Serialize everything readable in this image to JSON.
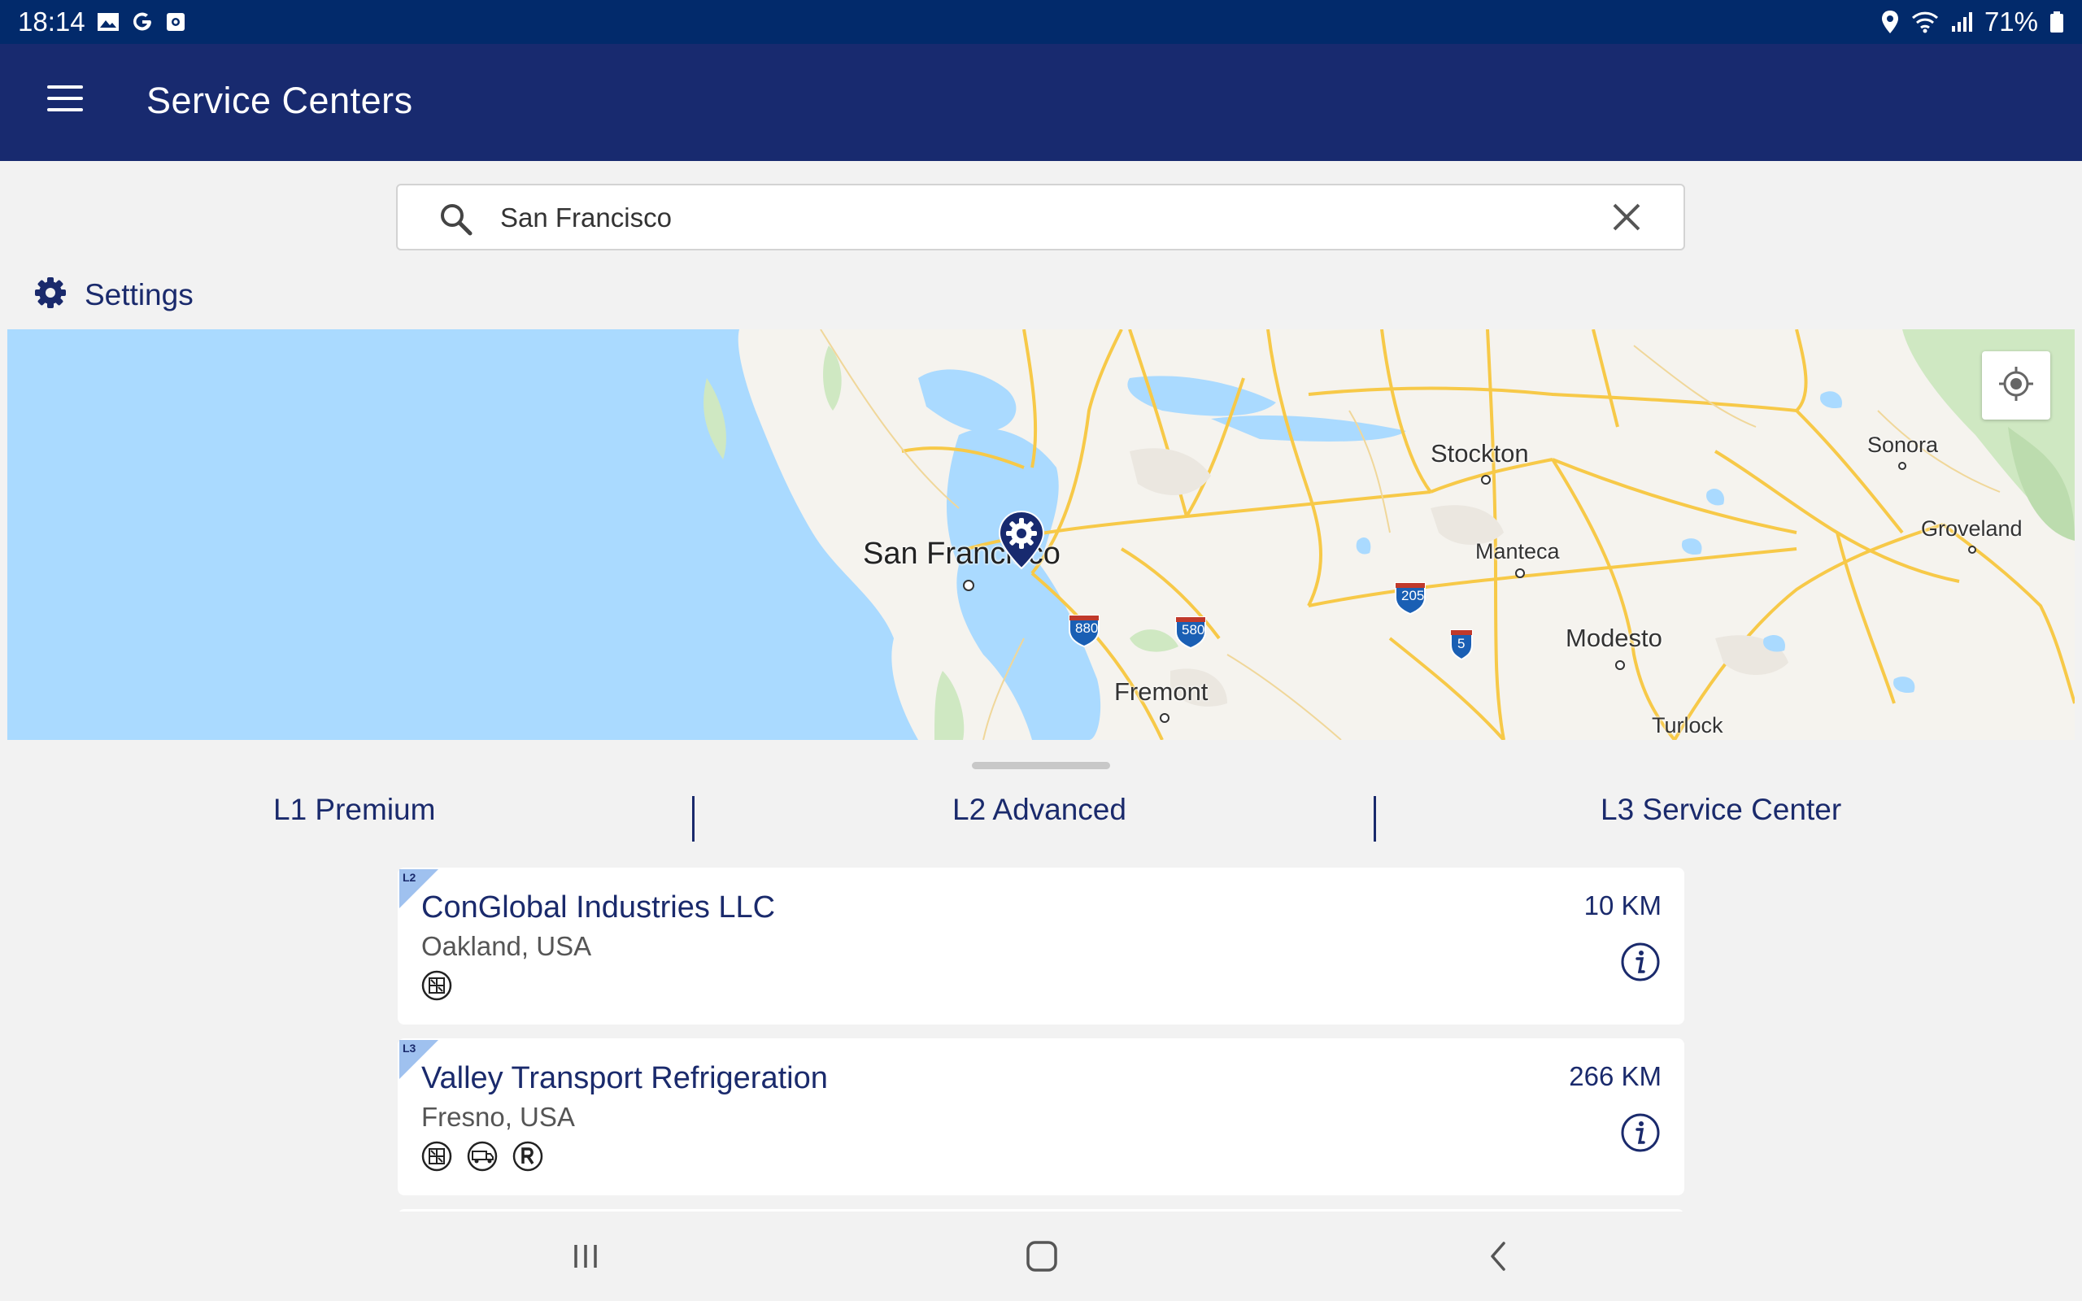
{
  "status_bar": {
    "time": "18:14",
    "battery": "71%",
    "icons_left": [
      "gallery-icon",
      "google-icon",
      "outlook-icon"
    ],
    "icons_right": [
      "location-icon",
      "wifi-icon",
      "signal-icon",
      "battery-icon"
    ]
  },
  "app_bar": {
    "title": "Service Centers",
    "menu_icon": "hamburger-menu-icon"
  },
  "search": {
    "value": "San Francisco",
    "placeholder": ""
  },
  "settings": {
    "label": "Settings"
  },
  "map": {
    "labels": {
      "san_francisco": "San Francisco",
      "stockton": "Stockton",
      "manteca": "Manteca",
      "modesto": "Modesto",
      "fremont": "Fremont",
      "turlock": "Turlock",
      "sonora": "Sonora",
      "groveland": "Groveland"
    },
    "highways": {
      "i880": "880",
      "i580": "580",
      "i205": "205",
      "i5": "5"
    },
    "colors": {
      "water": "#aadaff",
      "land": "#f5f3ee",
      "road": "#fbd66a",
      "park": "#cfe8c2"
    }
  },
  "tabs": [
    {
      "label": "L1 Premium"
    },
    {
      "label": "L2 Advanced"
    },
    {
      "label": "L3 Service Center"
    }
  ],
  "results": [
    {
      "level": "L2",
      "name": "ConGlobal Industries LLC",
      "city": "Oakland, USA",
      "distance": "10  KM",
      "service_icons": [
        "container-reefer-icon"
      ]
    },
    {
      "level": "L3",
      "name": "Valley Transport Refrigeration",
      "city": "Fresno, USA",
      "distance": "266  KM",
      "service_icons": [
        "container-reefer-icon",
        "truck-icon",
        "r-icon"
      ]
    }
  ],
  "colors": {
    "status_bar": "#022a6b",
    "app_bar": "#182a6f",
    "accent": "#1a2a6c",
    "tag": "#9fc1ef"
  }
}
